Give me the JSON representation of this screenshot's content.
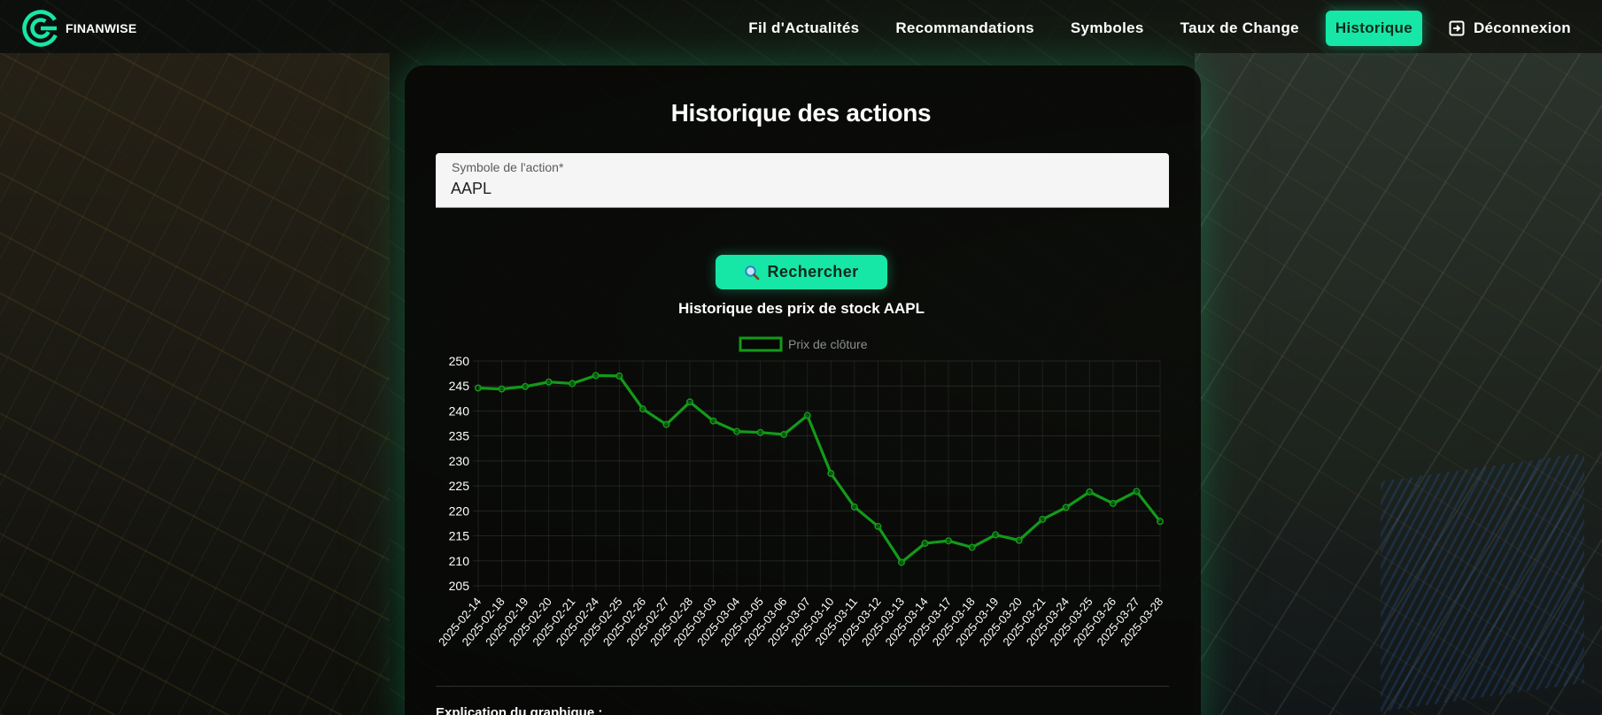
{
  "brand": {
    "name": "FINANWISE"
  },
  "nav": {
    "items": [
      {
        "label": "Fil d'Actualités"
      },
      {
        "label": "Recommandations"
      },
      {
        "label": "Symboles"
      },
      {
        "label": "Taux de Change"
      },
      {
        "label": "Historique"
      }
    ],
    "logout_label": "Déconnexion"
  },
  "page": {
    "title": "Historique des actions",
    "field_label": "Symbole de l'action*",
    "field_value": "AAPL",
    "search_button": "Rechercher",
    "explanation_heading": "Explication du graphique :"
  },
  "colors": {
    "accent": "#17e7a6",
    "line": "#139a19"
  },
  "chart_data": {
    "type": "line",
    "title": "Historique des prix de stock AAPL",
    "legend_position": "top-center",
    "grid": true,
    "ylim": [
      205,
      250
    ],
    "yticks": [
      205,
      210,
      215,
      220,
      225,
      230,
      235,
      240,
      245,
      250
    ],
    "categories": [
      "2025-02-14",
      "2025-02-18",
      "2025-02-19",
      "2025-02-20",
      "2025-02-21",
      "2025-02-24",
      "2025-02-25",
      "2025-02-26",
      "2025-02-27",
      "2025-02-28",
      "2025-03-03",
      "2025-03-04",
      "2025-03-05",
      "2025-03-06",
      "2025-03-07",
      "2025-03-10",
      "2025-03-11",
      "2025-03-12",
      "2025-03-13",
      "2025-03-14",
      "2025-03-17",
      "2025-03-18",
      "2025-03-19",
      "2025-03-20",
      "2025-03-21",
      "2025-03-24",
      "2025-03-25",
      "2025-03-26",
      "2025-03-27",
      "2025-03-28"
    ],
    "series": [
      {
        "name": "Prix de clôture",
        "values": [
          244.6,
          244.4,
          244.9,
          245.8,
          245.5,
          247.1,
          247.0,
          240.4,
          237.3,
          241.8,
          238.0,
          235.9,
          235.7,
          235.3,
          239.1,
          227.5,
          220.8,
          216.9,
          209.7,
          213.5,
          214.0,
          212.7,
          215.2,
          214.1,
          218.3,
          220.7,
          223.8,
          221.5,
          223.9,
          217.9
        ]
      }
    ]
  }
}
